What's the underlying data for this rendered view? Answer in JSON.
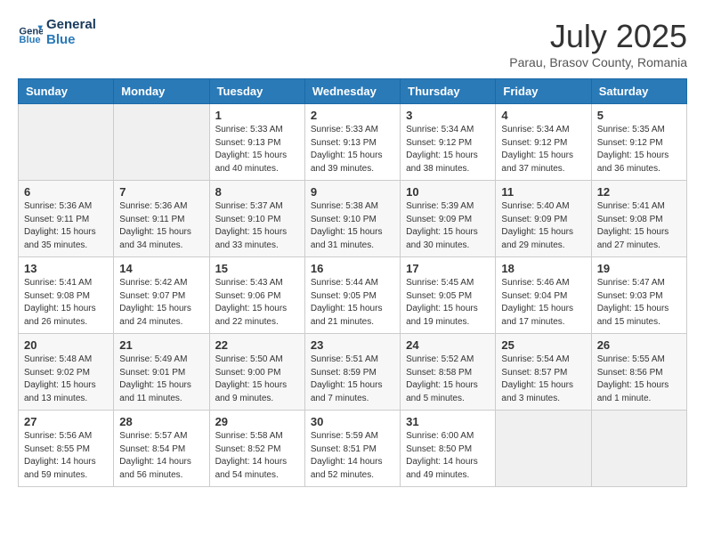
{
  "header": {
    "logo_line1": "General",
    "logo_line2": "Blue",
    "month": "July 2025",
    "location": "Parau, Brasov County, Romania"
  },
  "days_of_week": [
    "Sunday",
    "Monday",
    "Tuesday",
    "Wednesday",
    "Thursday",
    "Friday",
    "Saturday"
  ],
  "weeks": [
    [
      {
        "day": "",
        "info": ""
      },
      {
        "day": "",
        "info": ""
      },
      {
        "day": "1",
        "info": "Sunrise: 5:33 AM\nSunset: 9:13 PM\nDaylight: 15 hours\nand 40 minutes."
      },
      {
        "day": "2",
        "info": "Sunrise: 5:33 AM\nSunset: 9:13 PM\nDaylight: 15 hours\nand 39 minutes."
      },
      {
        "day": "3",
        "info": "Sunrise: 5:34 AM\nSunset: 9:12 PM\nDaylight: 15 hours\nand 38 minutes."
      },
      {
        "day": "4",
        "info": "Sunrise: 5:34 AM\nSunset: 9:12 PM\nDaylight: 15 hours\nand 37 minutes."
      },
      {
        "day": "5",
        "info": "Sunrise: 5:35 AM\nSunset: 9:12 PM\nDaylight: 15 hours\nand 36 minutes."
      }
    ],
    [
      {
        "day": "6",
        "info": "Sunrise: 5:36 AM\nSunset: 9:11 PM\nDaylight: 15 hours\nand 35 minutes."
      },
      {
        "day": "7",
        "info": "Sunrise: 5:36 AM\nSunset: 9:11 PM\nDaylight: 15 hours\nand 34 minutes."
      },
      {
        "day": "8",
        "info": "Sunrise: 5:37 AM\nSunset: 9:10 PM\nDaylight: 15 hours\nand 33 minutes."
      },
      {
        "day": "9",
        "info": "Sunrise: 5:38 AM\nSunset: 9:10 PM\nDaylight: 15 hours\nand 31 minutes."
      },
      {
        "day": "10",
        "info": "Sunrise: 5:39 AM\nSunset: 9:09 PM\nDaylight: 15 hours\nand 30 minutes."
      },
      {
        "day": "11",
        "info": "Sunrise: 5:40 AM\nSunset: 9:09 PM\nDaylight: 15 hours\nand 29 minutes."
      },
      {
        "day": "12",
        "info": "Sunrise: 5:41 AM\nSunset: 9:08 PM\nDaylight: 15 hours\nand 27 minutes."
      }
    ],
    [
      {
        "day": "13",
        "info": "Sunrise: 5:41 AM\nSunset: 9:08 PM\nDaylight: 15 hours\nand 26 minutes."
      },
      {
        "day": "14",
        "info": "Sunrise: 5:42 AM\nSunset: 9:07 PM\nDaylight: 15 hours\nand 24 minutes."
      },
      {
        "day": "15",
        "info": "Sunrise: 5:43 AM\nSunset: 9:06 PM\nDaylight: 15 hours\nand 22 minutes."
      },
      {
        "day": "16",
        "info": "Sunrise: 5:44 AM\nSunset: 9:05 PM\nDaylight: 15 hours\nand 21 minutes."
      },
      {
        "day": "17",
        "info": "Sunrise: 5:45 AM\nSunset: 9:05 PM\nDaylight: 15 hours\nand 19 minutes."
      },
      {
        "day": "18",
        "info": "Sunrise: 5:46 AM\nSunset: 9:04 PM\nDaylight: 15 hours\nand 17 minutes."
      },
      {
        "day": "19",
        "info": "Sunrise: 5:47 AM\nSunset: 9:03 PM\nDaylight: 15 hours\nand 15 minutes."
      }
    ],
    [
      {
        "day": "20",
        "info": "Sunrise: 5:48 AM\nSunset: 9:02 PM\nDaylight: 15 hours\nand 13 minutes."
      },
      {
        "day": "21",
        "info": "Sunrise: 5:49 AM\nSunset: 9:01 PM\nDaylight: 15 hours\nand 11 minutes."
      },
      {
        "day": "22",
        "info": "Sunrise: 5:50 AM\nSunset: 9:00 PM\nDaylight: 15 hours\nand 9 minutes."
      },
      {
        "day": "23",
        "info": "Sunrise: 5:51 AM\nSunset: 8:59 PM\nDaylight: 15 hours\nand 7 minutes."
      },
      {
        "day": "24",
        "info": "Sunrise: 5:52 AM\nSunset: 8:58 PM\nDaylight: 15 hours\nand 5 minutes."
      },
      {
        "day": "25",
        "info": "Sunrise: 5:54 AM\nSunset: 8:57 PM\nDaylight: 15 hours\nand 3 minutes."
      },
      {
        "day": "26",
        "info": "Sunrise: 5:55 AM\nSunset: 8:56 PM\nDaylight: 15 hours\nand 1 minute."
      }
    ],
    [
      {
        "day": "27",
        "info": "Sunrise: 5:56 AM\nSunset: 8:55 PM\nDaylight: 14 hours\nand 59 minutes."
      },
      {
        "day": "28",
        "info": "Sunrise: 5:57 AM\nSunset: 8:54 PM\nDaylight: 14 hours\nand 56 minutes."
      },
      {
        "day": "29",
        "info": "Sunrise: 5:58 AM\nSunset: 8:52 PM\nDaylight: 14 hours\nand 54 minutes."
      },
      {
        "day": "30",
        "info": "Sunrise: 5:59 AM\nSunset: 8:51 PM\nDaylight: 14 hours\nand 52 minutes."
      },
      {
        "day": "31",
        "info": "Sunrise: 6:00 AM\nSunset: 8:50 PM\nDaylight: 14 hours\nand 49 minutes."
      },
      {
        "day": "",
        "info": ""
      },
      {
        "day": "",
        "info": ""
      }
    ]
  ]
}
